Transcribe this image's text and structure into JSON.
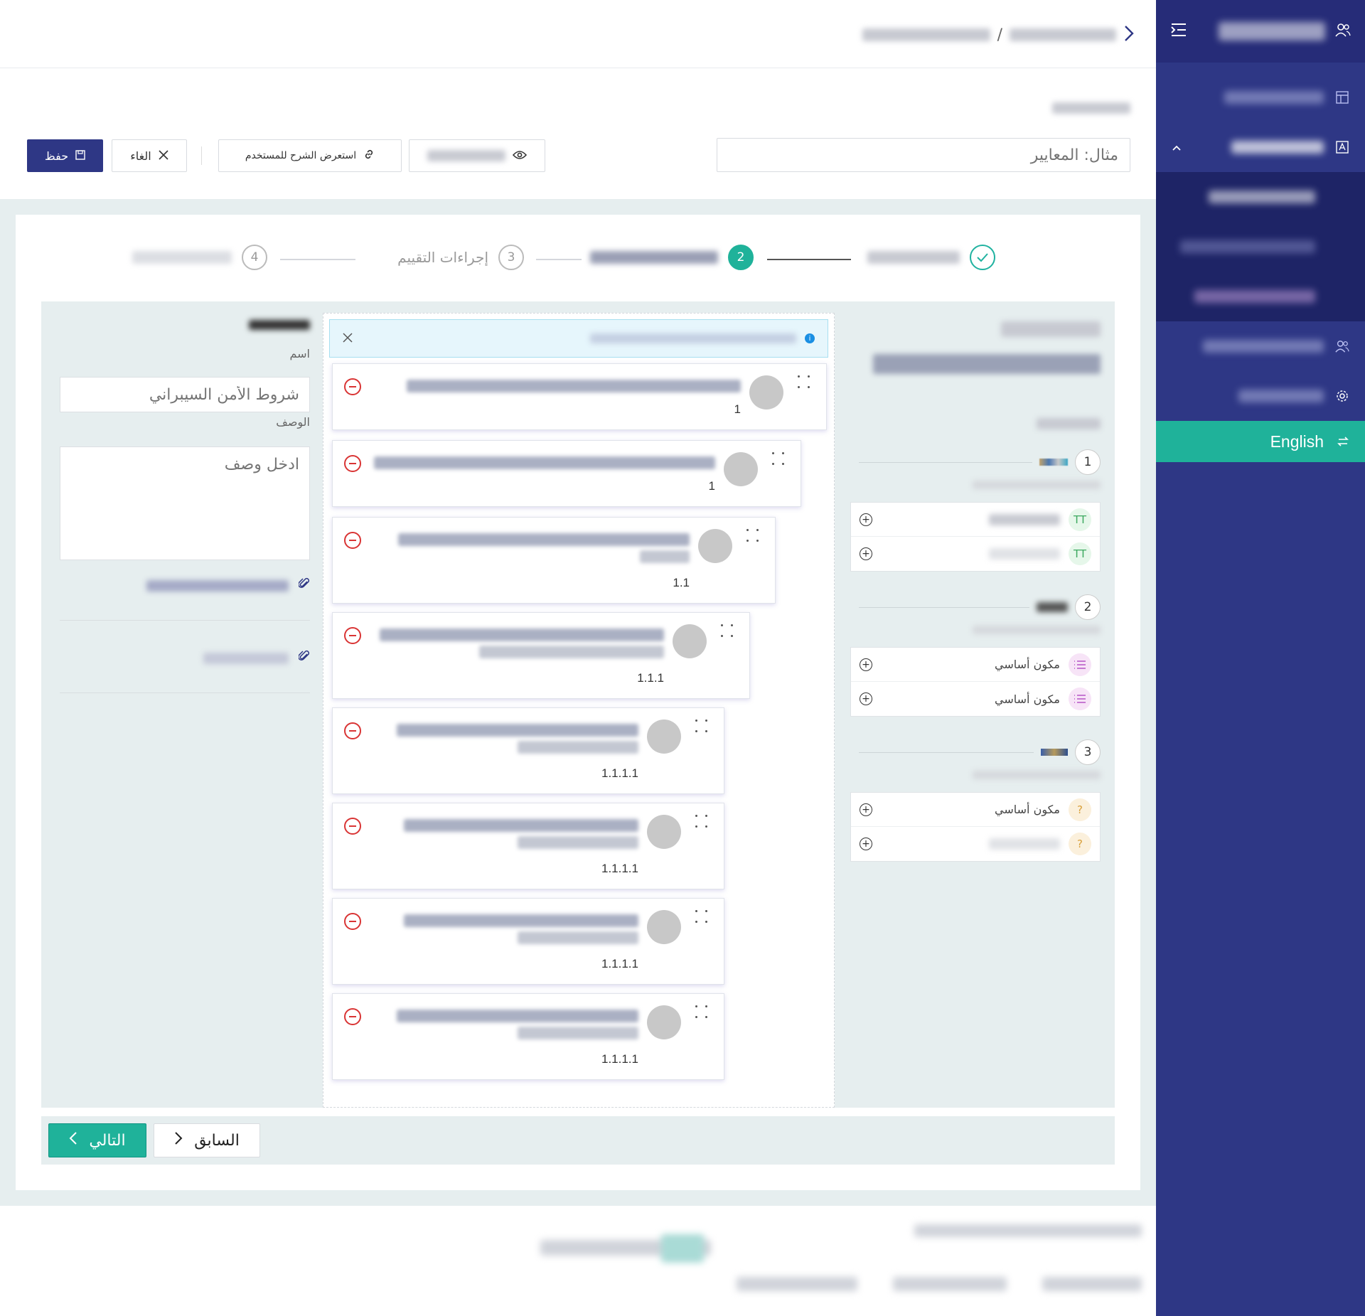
{
  "sidebar": {
    "lang_label": "English",
    "items_icons": [
      "dashboard-icon",
      "form-icon",
      "users-icon",
      "gear-icon"
    ]
  },
  "title_form": {
    "placeholder": "مثال: المعايير"
  },
  "toolbar": {
    "save_label": "حفظ",
    "cancel_label": "الغاء",
    "preview_user_label": "استعرض الشرح للمستخدم"
  },
  "stepper": {
    "steps": [
      {
        "number": "1",
        "state": "done"
      },
      {
        "number": "2",
        "state": "active"
      },
      {
        "number": "3",
        "label": "إجراءات التقييم",
        "state": "pending"
      },
      {
        "number": "4",
        "state": "pending"
      }
    ]
  },
  "palette": {
    "groups": [
      {
        "number": "1",
        "items": [
          {
            "badge": "TT",
            "kind": "text"
          },
          {
            "badge": "TT",
            "kind": "text"
          }
        ]
      },
      {
        "number": "2",
        "items": [
          {
            "badge": "list",
            "kind": "list",
            "name": "مكون أساسي"
          },
          {
            "badge": "list",
            "kind": "list",
            "name": "مكون أساسي"
          }
        ]
      },
      {
        "number": "3",
        "items": [
          {
            "badge": "?",
            "kind": "question",
            "name": "مكون أساسي"
          },
          {
            "badge": "?",
            "kind": "question"
          }
        ]
      }
    ]
  },
  "canvas": {
    "cards": [
      {
        "num": "1"
      },
      {
        "num": "1"
      },
      {
        "num": "1.1"
      },
      {
        "num": "1.1.1"
      },
      {
        "num": "1.1.1.1"
      },
      {
        "num": "1.1.1.1"
      },
      {
        "num": "1.1.1.1"
      },
      {
        "num": "1.1.1.1"
      }
    ]
  },
  "properties": {
    "name_label": "اسم",
    "name_placeholder": "شروط الأمن السيبراني",
    "desc_label": "الوصف",
    "desc_placeholder": "ادخل وصف"
  },
  "nav": {
    "next_label": "التالي",
    "prev_label": "السابق"
  }
}
